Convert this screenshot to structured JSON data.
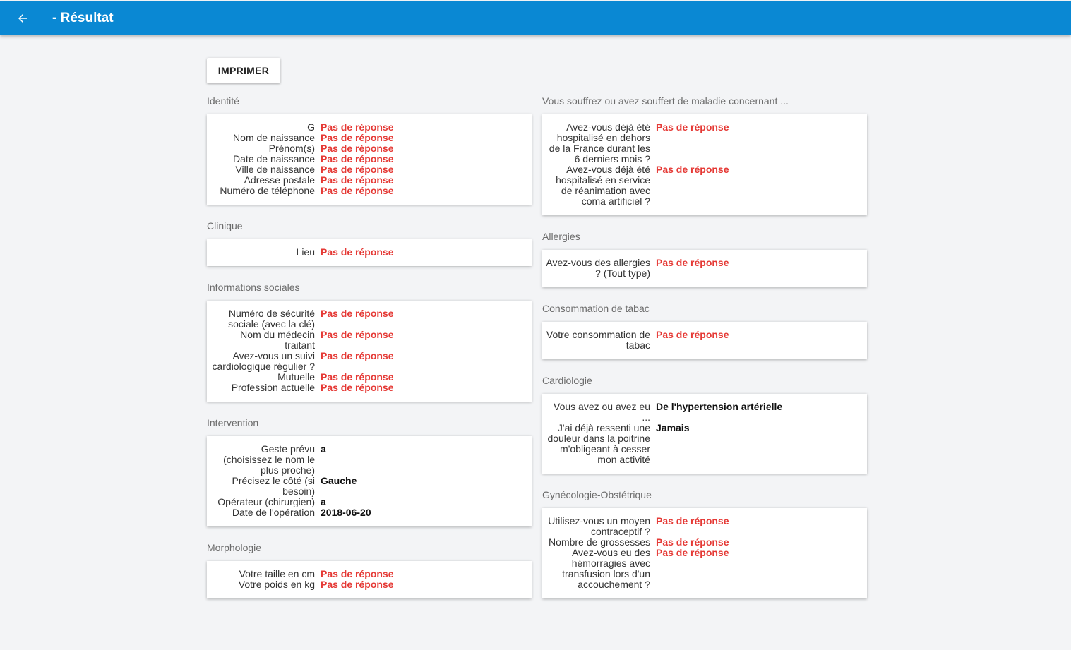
{
  "header": {
    "title": "- Résultat"
  },
  "actions": {
    "print_label": "IMPRIMER"
  },
  "left_sections": [
    {
      "title": "Identité",
      "rows": [
        {
          "q": "G",
          "a": "Pas de réponse",
          "empty": true
        },
        {
          "q": "Nom de naissance",
          "a": "Pas de réponse",
          "empty": true
        },
        {
          "q": "Prénom(s)",
          "a": "Pas de réponse",
          "empty": true
        },
        {
          "q": "Date de naissance",
          "a": "Pas de réponse",
          "empty": true
        },
        {
          "q": "Ville de naissance",
          "a": "Pas de réponse",
          "empty": true
        },
        {
          "q": "Adresse postale",
          "a": "Pas de réponse",
          "empty": true
        },
        {
          "q": "Numéro de téléphone",
          "a": "Pas de réponse",
          "empty": true
        }
      ]
    },
    {
      "title": "Clinique",
      "rows": [
        {
          "q": "Lieu",
          "a": "Pas de réponse",
          "empty": true
        }
      ]
    },
    {
      "title": "Informations sociales",
      "rows": [
        {
          "q": "Numéro de sécurité sociale (avec la clé)",
          "a": "Pas de réponse",
          "empty": true
        },
        {
          "q": "Nom du médecin traitant",
          "a": "Pas de réponse",
          "empty": true
        },
        {
          "q": "Avez-vous un suivi cardiologique régulier ?",
          "a": "Pas de réponse",
          "empty": true
        },
        {
          "q": "Mutuelle",
          "a": "Pas de réponse",
          "empty": true
        },
        {
          "q": "Profession actuelle",
          "a": "Pas de réponse",
          "empty": true
        }
      ]
    },
    {
      "title": "Intervention",
      "rows": [
        {
          "q": "Geste prévu (choisissez le nom le plus proche)",
          "a": "a",
          "empty": false
        },
        {
          "q": "Précisez le côté (si besoin)",
          "a": "Gauche",
          "empty": false
        },
        {
          "q": "Opérateur (chirurgien)",
          "a": "a",
          "empty": false
        },
        {
          "q": "Date de l'opération",
          "a": "2018-06-20",
          "empty": false
        }
      ]
    },
    {
      "title": "Morphologie",
      "rows": [
        {
          "q": "Votre taille en cm",
          "a": "Pas de réponse",
          "empty": true
        },
        {
          "q": "Votre poids en kg",
          "a": "Pas de réponse",
          "empty": true
        }
      ]
    }
  ],
  "right_sections": [
    {
      "title": "Vous souffrez ou avez souffert de maladie concernant ...",
      "rows": [
        {
          "q": "Avez-vous déjà été hospitalisé en dehors de la France durant les 6 derniers mois ?",
          "a": "Pas de réponse",
          "empty": true
        },
        {
          "q": "Avez-vous déjà été hospitalisé en service de réanimation avec coma artificiel ?",
          "a": "Pas de réponse",
          "empty": true
        }
      ]
    },
    {
      "title": "Allergies",
      "rows": [
        {
          "q": "Avez-vous des allergies ? (Tout type)",
          "a": "Pas de réponse",
          "empty": true
        }
      ]
    },
    {
      "title": "Consommation de tabac",
      "rows": [
        {
          "q": "Votre consommation de tabac",
          "a": "Pas de réponse",
          "empty": true
        }
      ]
    },
    {
      "title": "Cardiologie",
      "rows": [
        {
          "q": "Vous avez ou avez eu ...",
          "a": "De l'hypertension artérielle",
          "empty": false
        },
        {
          "q": "J'ai déjà ressenti une douleur dans la poitrine m'obligeant à cesser mon activité",
          "a": "Jamais",
          "empty": false
        }
      ]
    },
    {
      "title": "Gynécologie-Obstétrique",
      "rows": [
        {
          "q": "Utilisez-vous un moyen contraceptif ?",
          "a": "Pas de réponse",
          "empty": true
        },
        {
          "q": "Nombre de grossesses",
          "a": "Pas de réponse",
          "empty": true
        },
        {
          "q": "Avez-vous eu des hémorragies avec transfusion lors d'un accouchement ?",
          "a": "Pas de réponse",
          "empty": true
        }
      ]
    }
  ],
  "colors": {
    "header": "#0a88d3",
    "empty_answer": "#e53935",
    "background": "#f3f4f6"
  },
  "icons": {
    "back": "arrow-left-icon"
  }
}
